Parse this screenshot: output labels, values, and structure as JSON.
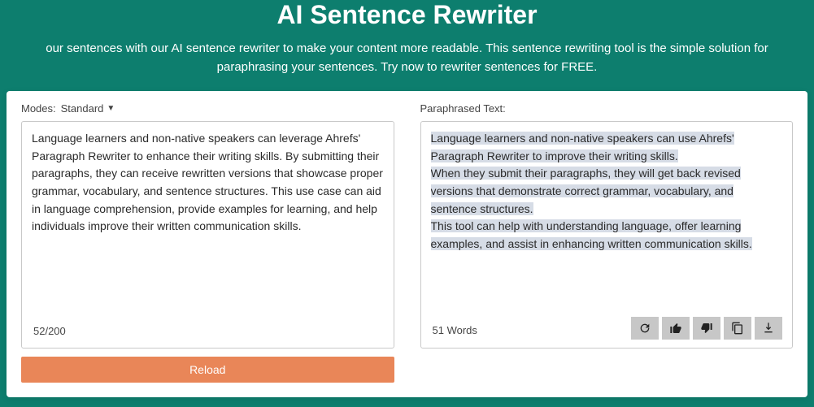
{
  "header": {
    "title": "AI Sentence Rewriter",
    "subtitle": "our sentences with our AI sentence rewriter to make your content more readable. This sentence rewriting tool is the simple solution for paraphrasing your sentences. Try now to rewriter sentences for FREE."
  },
  "input": {
    "modes_label": "Modes:",
    "mode_selected": "Standard",
    "text": "Language learners and non-native speakers can leverage Ahrefs' Paragraph Rewriter to enhance their writing skills. By submitting their paragraphs, they can receive rewritten versions that showcase proper grammar, vocabulary, and sentence structures. This use case can aid in language comprehension, provide examples for learning, and help individuals improve their written communication skills.",
    "counter": "52/200",
    "reload_label": "Reload"
  },
  "output": {
    "label": "Paraphrased Text:",
    "sentence1": "Language learners and non-native speakers can use Ahrefs' Paragraph Rewriter to improve their writing skills.",
    "sentence2": "When they submit their paragraphs, they will get back revised versions that demonstrate correct grammar, vocabulary, and sentence structures.",
    "sentence3": "This tool can help with understanding language, offer learning examples, and assist in enhancing written communication skills.",
    "word_count": "51 Words"
  }
}
